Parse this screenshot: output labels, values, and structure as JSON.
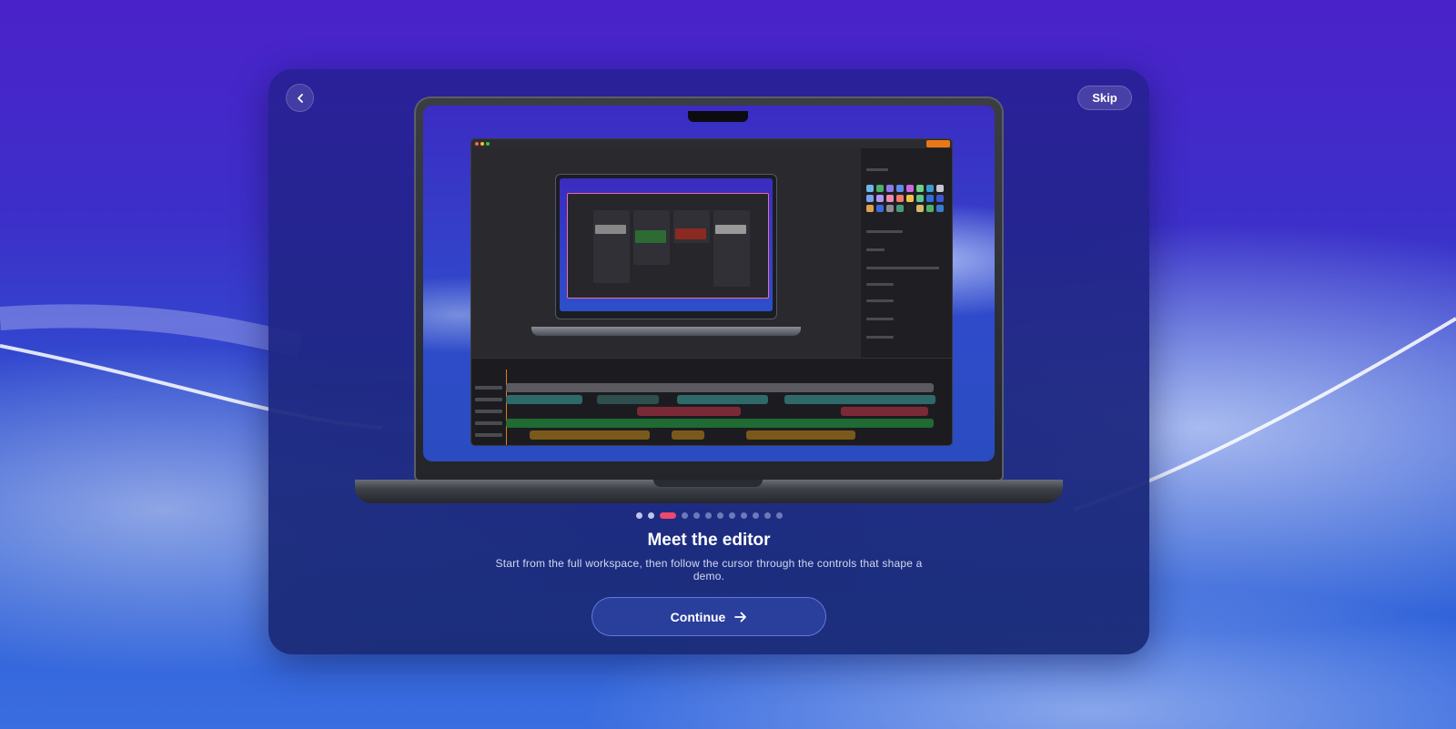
{
  "header": {
    "back_icon": "chevron-left-icon",
    "skip_label": "Skip"
  },
  "pager": {
    "total": 13,
    "active_index": 2
  },
  "step": {
    "title": "Meet the editor",
    "description": "Start from the full workspace, then follow the cursor through the controls that shape a demo."
  },
  "actions": {
    "continue_label": "Continue",
    "continue_icon": "arrow-right-icon"
  },
  "colors": {
    "accent_active_dot": "#f0476e",
    "export_orange": "#e8781a",
    "preview_frame_pink": "#f06aa0"
  }
}
